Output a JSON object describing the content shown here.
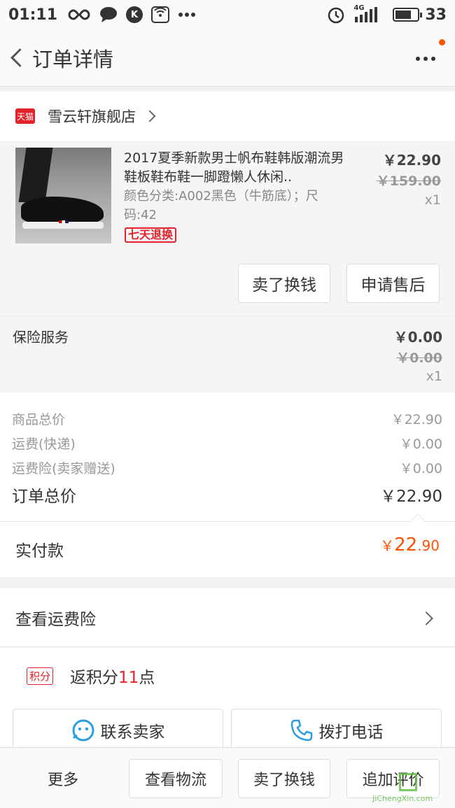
{
  "status_bar": {
    "time": "01:11",
    "k_badge": "K",
    "network": "4G",
    "battery": "33",
    "battery_level_percent": 75
  },
  "nav": {
    "title": "订单详情"
  },
  "shop": {
    "badge": "天猫",
    "name": "雪云轩旗舰店"
  },
  "item": {
    "title": "2017夏季新款男士帆布鞋韩版潮流男鞋板鞋布鞋一脚蹬懒人休闲..",
    "spec": "颜色分类:A002黑色（牛筋底）；尺码:42",
    "return_tag": "七天退换",
    "price": "￥22.90",
    "original_price": "￥159.00",
    "quantity": "x1",
    "sell_button": "卖了换钱",
    "aftersale_button": "申请售后"
  },
  "insurance": {
    "label": "保险服务",
    "price": "￥0.00",
    "original_price": "￥0.00",
    "quantity": "x1"
  },
  "summary": {
    "rows": [
      {
        "label": "商品总价",
        "value": "￥22.90"
      },
      {
        "label": "运费(快递)",
        "value": "￥0.00"
      },
      {
        "label": "运费险(卖家赠送)",
        "value": "￥0.00"
      }
    ],
    "total_label": "订单总价",
    "total_value": "￥22.90",
    "paid_label": "实付款",
    "paid_currency": "￥",
    "paid_int": "22",
    "paid_dec": ".90"
  },
  "freight_insurance": {
    "label": "查看运费险"
  },
  "points": {
    "badge": "积分",
    "prefix": "返积分",
    "number": "11",
    "suffix": "点"
  },
  "contact": {
    "seller": "联系卖家",
    "call": "拨打电话"
  },
  "bottom_bar": {
    "more": "更多",
    "logistics": "查看物流",
    "sell": "卖了换钱",
    "review": "追加评价"
  },
  "watermark": {
    "text": "JiChengXin.com"
  },
  "colors": {
    "accent": "#ff5000",
    "tmall_red": "#e4222a",
    "link_blue": "#2b9ee3"
  }
}
